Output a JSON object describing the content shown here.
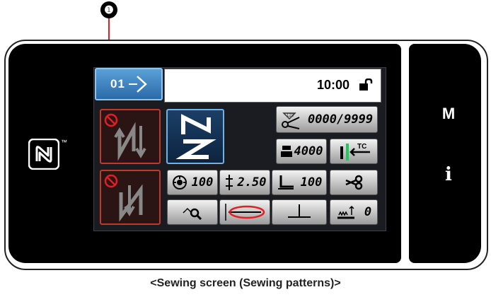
{
  "callout": {
    "number": "❶"
  },
  "screen": {
    "pattern_button": {
      "number": "01",
      "icon": "sewing-pattern-arrow-icon"
    },
    "status": {
      "time": "10:00",
      "lock_icon": "unlock-icon"
    },
    "counter": {
      "value": "0000/9999",
      "icon": "thread-trimmer-counter-icon"
    },
    "bobbin": {
      "value": "4000",
      "icon": "bobbin-counter-icon"
    },
    "tc_button": {
      "label": "TC",
      "icon": "thread-clamp-icon"
    },
    "reverse_start_button": {
      "icon": "reverse-feed-start-icon",
      "state": "disabled"
    },
    "reverse_end_button": {
      "icon": "reverse-feed-end-icon",
      "state": "disabled"
    },
    "zigzag_button": {
      "icon": "sewing-pattern-zigzag-icon"
    },
    "speed": {
      "value": "100",
      "icon": "sewing-speed-icon"
    },
    "pitch": {
      "value": "2.50",
      "icon": "stitch-pitch-icon"
    },
    "presser": {
      "value": "100",
      "icon": "presser-foot-icon"
    },
    "trim_button": {
      "icon": "thread-trimmer-icon"
    },
    "search_button": {
      "icon": "pattern-search-icon"
    },
    "stitch_shape_button": {
      "icon": "stitch-shape-icon"
    },
    "needle_button": {
      "icon": "needle-position-icon"
    },
    "feed": {
      "value": "0",
      "icon": "feed-height-icon"
    }
  },
  "side": {
    "m_label": "M",
    "i_label": "i"
  },
  "caption": "<Sewing screen (Sewing patterns)>",
  "colors": {
    "accent_blue": "#2a6aa8",
    "disabled_red": "#e31e24",
    "screen_bg": "#1a1c22",
    "tc_green": "#22c55e"
  }
}
